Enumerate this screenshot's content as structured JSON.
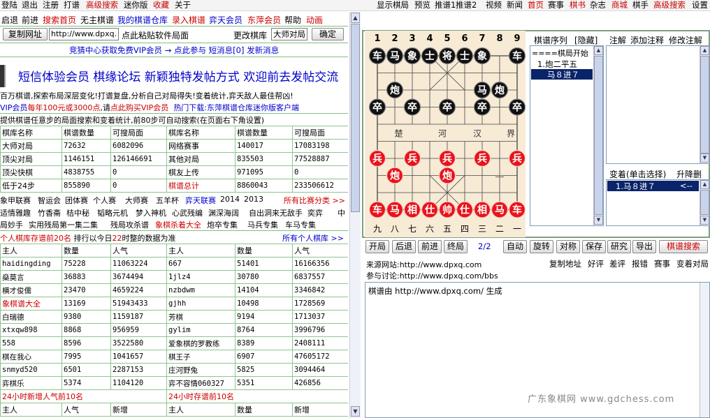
{
  "topbar": {
    "left": [
      {
        "label": "登陆",
        "c": ""
      },
      {
        "label": "退出",
        "c": ""
      },
      {
        "label": "注册",
        "c": ""
      },
      {
        "label": "打谱",
        "c": ""
      },
      {
        "label": "高级搜索",
        "c": "red"
      },
      {
        "label": "迷你版",
        "c": ""
      },
      {
        "label": "收藏",
        "c": "red"
      },
      {
        "label": "关于",
        "c": ""
      }
    ],
    "right": [
      {
        "label": "显示棋局",
        "c": ""
      },
      {
        "label": "预览",
        "c": ""
      },
      {
        "label": "推谱1",
        "c": ""
      },
      {
        "label": "推谱2",
        "c": ""
      },
      {
        "label": "视频",
        "c": ""
      },
      {
        "label": "新闻",
        "c": ""
      },
      {
        "label": "首页",
        "c": "red"
      },
      {
        "label": "赛事",
        "c": ""
      },
      {
        "label": "棋书",
        "c": "red"
      },
      {
        "label": "杂志",
        "c": ""
      },
      {
        "label": "商城",
        "c": "red"
      },
      {
        "label": "棋手",
        "c": ""
      },
      {
        "label": "高级搜索",
        "c": "red"
      },
      {
        "label": "设置",
        "c": ""
      }
    ]
  },
  "nav": [
    {
      "label": "启退",
      "c": ""
    },
    {
      "label": "前进",
      "c": ""
    },
    {
      "label": "搜索首页",
      "c": "red"
    },
    {
      "label": "无主棋谱",
      "c": ""
    },
    {
      "label": "我的棋谱仓库",
      "c": "blue"
    },
    {
      "label": "录入棋谱",
      "c": "red"
    },
    {
      "label": "弈天会员",
      "c": "blue"
    },
    {
      "label": "东萍会员",
      "c": "red"
    },
    {
      "label": "帮助",
      "c": ""
    },
    {
      "label": "动画",
      "c": "red"
    }
  ],
  "urlbar": {
    "copy_button": "复制网址",
    "url_value": "http://www.dpxq.",
    "paste_hint": "点此粘贴软件局面",
    "change_lib": "更改棋库",
    "lib_value": "大师对局",
    "ok_button": "确定"
  },
  "notice": {
    "a": "竞猜中心获取免费VIP会员",
    "b": "→ 点此参与",
    "c": "短消息[0]",
    "d": "发新消息"
  },
  "promo": "短信体验会员  棋缘论坛  新颖独特发帖方式  欢迎前去发帖交流",
  "intro": {
    "line1": "百万棋谱,探索布局深层变化!打谱复盘,分析自己对局得失!变着统计,弈天敌人最佳帮凶!",
    "line2a": "VIP会员",
    "line2b": "每年100元或3000点",
    "line2c": ",请",
    "line2d": "点此购买VIP会员",
    "line2e": "热门下载:东萍棋谱仓库迷你版客户端",
    "line3": "提供棋谱任意步的局面搜索和变着统计,前80步可自动搜索(在页面右下角设置)"
  },
  "libtable": {
    "headers": [
      "棋库名称",
      "棋谱数量",
      "可搜局面",
      "棋库名称",
      "棋谱数量",
      "可搜局面"
    ],
    "rows": [
      [
        "大师对局",
        "72632",
        "6082096",
        "网络赛事",
        "140017",
        "17083198"
      ],
      [
        "顶尖对局",
        "1146151",
        "126146691",
        "其他对局",
        "835503",
        "77528887"
      ],
      [
        "顶尖快棋",
        "4838755",
        "0",
        "棋友上传",
        "971095",
        "0"
      ],
      [
        "低于24步",
        "855890",
        "0",
        "棋谱总计",
        "8860043",
        "233506612"
      ]
    ]
  },
  "events": {
    "line1": [
      "象甲联赛",
      "智运会",
      "团体赛",
      "个人赛",
      "大师赛",
      "五羊杯",
      "弈天联赛",
      "2014",
      "2013"
    ],
    "line1_more": "所有比赛分类 >>",
    "line2": [
      "适情雅趣",
      "竹香斋",
      "桔中秘",
      "韬略元机",
      "梦入神机",
      "心武残编",
      "渊深海阔",
      "自出洞来无敌手",
      "奕弈",
      "中"
    ],
    "line3": [
      "局妙手",
      "实用残局第一集二集",
      "残局攻杀谱",
      "象棋杀着大全",
      "炮卒专集",
      "马兵专集",
      "车马专集"
    ]
  },
  "rank": {
    "title_a": "个人棋库存谱前20名",
    "title_b": "排行以今日",
    "title_c": "22",
    "title_d": "时整的数据为准",
    "more": "所有个人棋库 >>",
    "headers": [
      "主人",
      "数量",
      "人气",
      "主人",
      "数量",
      "人气"
    ],
    "rows": [
      [
        "haidingding",
        "75228",
        "11063224",
        "667",
        "51401",
        "16166356"
      ],
      [
        "燊莫言",
        "36883",
        "3674494",
        "1jlz4",
        "30780",
        "6837557"
      ],
      [
        "横才俊儒",
        "23470",
        "4659224",
        "nzbdwm",
        "14104",
        "3346842"
      ],
      [
        "象棋谱大全",
        "13169",
        "51943433",
        "gjhh",
        "10498",
        "1728569"
      ],
      [
        "白瑞德",
        "9380",
        "1159187",
        "芳棋",
        "9194",
        "1713037"
      ],
      [
        "xtxqw898",
        "8868",
        "956959",
        "gylim",
        "8764",
        "3996796"
      ],
      [
        "558",
        "8596",
        "3522580",
        "爱象棋的罗教练",
        "8389",
        "2408111"
      ],
      [
        "棋在我心",
        "7995",
        "1041657",
        "棋王子",
        "6907",
        "47605172"
      ],
      [
        "snmyd520",
        "6501",
        "2287153",
        "庄河野兔",
        "5825",
        "3094464"
      ],
      [
        "弈棋乐",
        "5374",
        "1104120",
        "弈不容情060327",
        "5351",
        "426856"
      ]
    ],
    "foot_a": "24小时新增人气前10名",
    "foot_b": "24小时存谱前10名",
    "foot_headers": [
      "主人",
      "人气",
      "新增",
      "主人",
      "数量",
      "新增"
    ]
  },
  "board": {
    "top_files": [
      "1",
      "2",
      "3",
      "4",
      "5",
      "6",
      "7",
      "8",
      "9"
    ],
    "bottom_files": [
      "九",
      "八",
      "七",
      "六",
      "五",
      "四",
      "三",
      "二",
      "一"
    ],
    "river": [
      "楚",
      "河",
      "汉",
      "界"
    ],
    "pieces": [
      {
        "t": "车",
        "s": "b",
        "c": 0,
        "r": 0
      },
      {
        "t": "马",
        "s": "b",
        "c": 1,
        "r": 0
      },
      {
        "t": "象",
        "s": "b",
        "c": 2,
        "r": 0
      },
      {
        "t": "士",
        "s": "b",
        "c": 3,
        "r": 0
      },
      {
        "t": "将",
        "s": "b",
        "c": 4,
        "r": 0
      },
      {
        "t": "士",
        "s": "b",
        "c": 5,
        "r": 0
      },
      {
        "t": "象",
        "s": "b",
        "c": 6,
        "r": 0
      },
      {
        "t": "车",
        "s": "b",
        "c": 8,
        "r": 0
      },
      {
        "t": "炮",
        "s": "b",
        "c": 1,
        "r": 2
      },
      {
        "t": "马",
        "s": "b",
        "c": 6,
        "r": 2
      },
      {
        "t": "炮",
        "s": "b",
        "c": 7,
        "r": 2
      },
      {
        "t": "卒",
        "s": "b",
        "c": 0,
        "r": 3
      },
      {
        "t": "卒",
        "s": "b",
        "c": 2,
        "r": 3
      },
      {
        "t": "卒",
        "s": "b",
        "c": 4,
        "r": 3
      },
      {
        "t": "卒",
        "s": "b",
        "c": 6,
        "r": 3
      },
      {
        "t": "卒",
        "s": "b",
        "c": 8,
        "r": 3
      },
      {
        "t": "兵",
        "s": "r",
        "c": 0,
        "r": 6
      },
      {
        "t": "兵",
        "s": "r",
        "c": 2,
        "r": 6
      },
      {
        "t": "兵",
        "s": "r",
        "c": 4,
        "r": 6
      },
      {
        "t": "兵",
        "s": "r",
        "c": 6,
        "r": 6
      },
      {
        "t": "兵",
        "s": "r",
        "c": 8,
        "r": 6
      },
      {
        "t": "炮",
        "s": "r",
        "c": 1,
        "r": 7
      },
      {
        "t": "炮",
        "s": "r",
        "c": 4,
        "r": 7
      },
      {
        "t": "车",
        "s": "r",
        "c": 0,
        "r": 9
      },
      {
        "t": "马",
        "s": "r",
        "c": 1,
        "r": 9
      },
      {
        "t": "相",
        "s": "r",
        "c": 2,
        "r": 9
      },
      {
        "t": "仕",
        "s": "r",
        "c": 3,
        "r": 9
      },
      {
        "t": "帅",
        "s": "r",
        "c": 4,
        "r": 9
      },
      {
        "t": "仕",
        "s": "r",
        "c": 5,
        "r": 9
      },
      {
        "t": "相",
        "s": "r",
        "c": 6,
        "r": 9
      },
      {
        "t": "马",
        "s": "r",
        "c": 7,
        "r": 9
      },
      {
        "t": "车",
        "s": "r",
        "c": 8,
        "r": 9
      }
    ]
  },
  "moves": {
    "header": "棋谱序列",
    "hide": "[隐藏]",
    "items": [
      "====棋局开始",
      "1.炮二平五",
      "马８进７"
    ]
  },
  "notes": {
    "header_a": "注解",
    "header_b": "添加注释",
    "header_c": "修改注解"
  },
  "variations": {
    "header": "变着(单击选择)",
    "sort": "升降删",
    "item": "1.马８进７",
    "item_arrow": "<--"
  },
  "toolbar": {
    "left": [
      "开局",
      "后退",
      "前进",
      "终局"
    ],
    "counter": "2/2",
    "right": [
      "自动",
      "旋转",
      "对称",
      "保存",
      "研究",
      "导出"
    ],
    "search": "棋谱搜索"
  },
  "source": {
    "site_label": "来源网站:http://www.dpxq.com",
    "bbs_label": "参与讨论:http://www.dpxq.com/bbs",
    "links": [
      "复制地址",
      "好评",
      "差评",
      "报错",
      "赛事",
      "变着",
      "对局"
    ]
  },
  "memo": "棋谱由 http://www.dpxq.com/ 生成",
  "watermark": "广东象棋网 www.gdchess.com"
}
